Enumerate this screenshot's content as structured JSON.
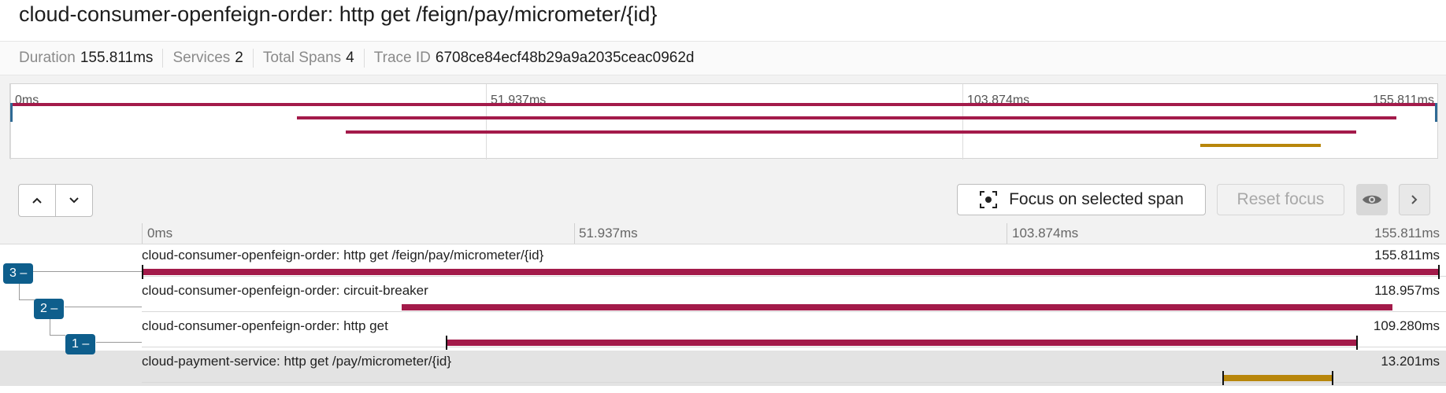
{
  "trace": {
    "title": "cloud-consumer-openfeign-order: http get /feign/pay/micrometer/{id}",
    "stats": [
      {
        "key": "Duration",
        "value": "155.811ms"
      },
      {
        "key": "Services",
        "value": "2"
      },
      {
        "key": "Total Spans",
        "value": "4"
      },
      {
        "key": "Trace ID",
        "value": "6708ce84ecf48b29a9a2035ceac0962d"
      }
    ]
  },
  "minimap": {
    "ticks": [
      "0ms",
      "51.937ms",
      "103.874ms",
      "155.811ms"
    ]
  },
  "toolbar": {
    "up_icon": "chevron-up-icon",
    "down_icon": "chevron-down-icon",
    "focus_label": "Focus on selected span",
    "focus_icon": "focus-target-icon",
    "reset_label": "Reset focus",
    "eye_icon": "eye-icon",
    "next_icon": "chevron-right-icon"
  },
  "timeline": {
    "ticks": [
      "0ms",
      "51.937ms",
      "103.874ms",
      "155.811ms"
    ]
  },
  "badges": [
    "3 –",
    "2 –",
    "1 –"
  ],
  "spans": [
    {
      "name": "cloud-consumer-openfeign-order: http get /feign/pay/micrometer/{id}",
      "duration": "155.811ms",
      "color": "#a31a4a"
    },
    {
      "name": "cloud-consumer-openfeign-order: circuit-breaker",
      "duration": "118.957ms",
      "color": "#a31a4a"
    },
    {
      "name": "cloud-consumer-openfeign-order: http get",
      "duration": "109.280ms",
      "color": "#a31a4a"
    },
    {
      "name": "cloud-payment-service: http get /pay/micrometer/{id}",
      "duration": "13.201ms",
      "color": "#b8860b"
    }
  ]
}
